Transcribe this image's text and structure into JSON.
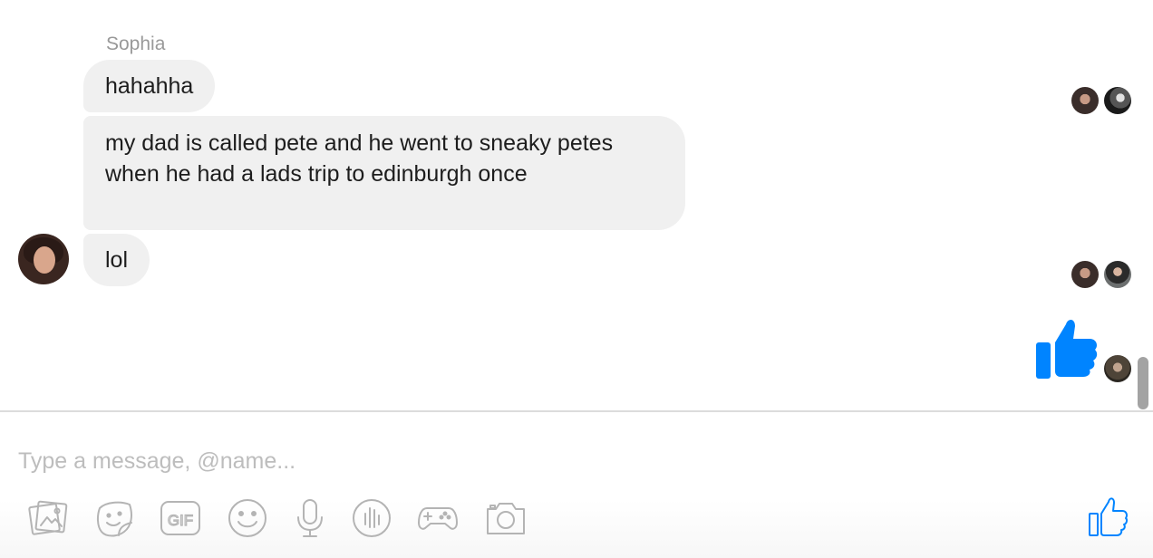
{
  "conversation": {
    "sender_name": "Sophia",
    "messages": [
      {
        "text": "hahahha"
      },
      {
        "text": "my dad is called pete and he went to sneaky petes when he had a lads trip to edinburgh once"
      },
      {
        "text": "lol"
      }
    ],
    "sent_reaction": "thumbs-up-icon"
  },
  "composer": {
    "placeholder": "Type a message, @name...",
    "value": "",
    "tools": [
      "image-icon",
      "sticker-icon",
      "gif-icon",
      "emoji-icon",
      "microphone-icon",
      "audio-clip-icon",
      "game-controller-icon",
      "camera-icon"
    ],
    "send_button_icon": "thumbs-up-icon"
  },
  "colors": {
    "accent": "#0084ff",
    "bubble_bg": "#f0f0f0",
    "icon_gray": "#b4b4b4",
    "placeholder": "#bdbdbd"
  }
}
